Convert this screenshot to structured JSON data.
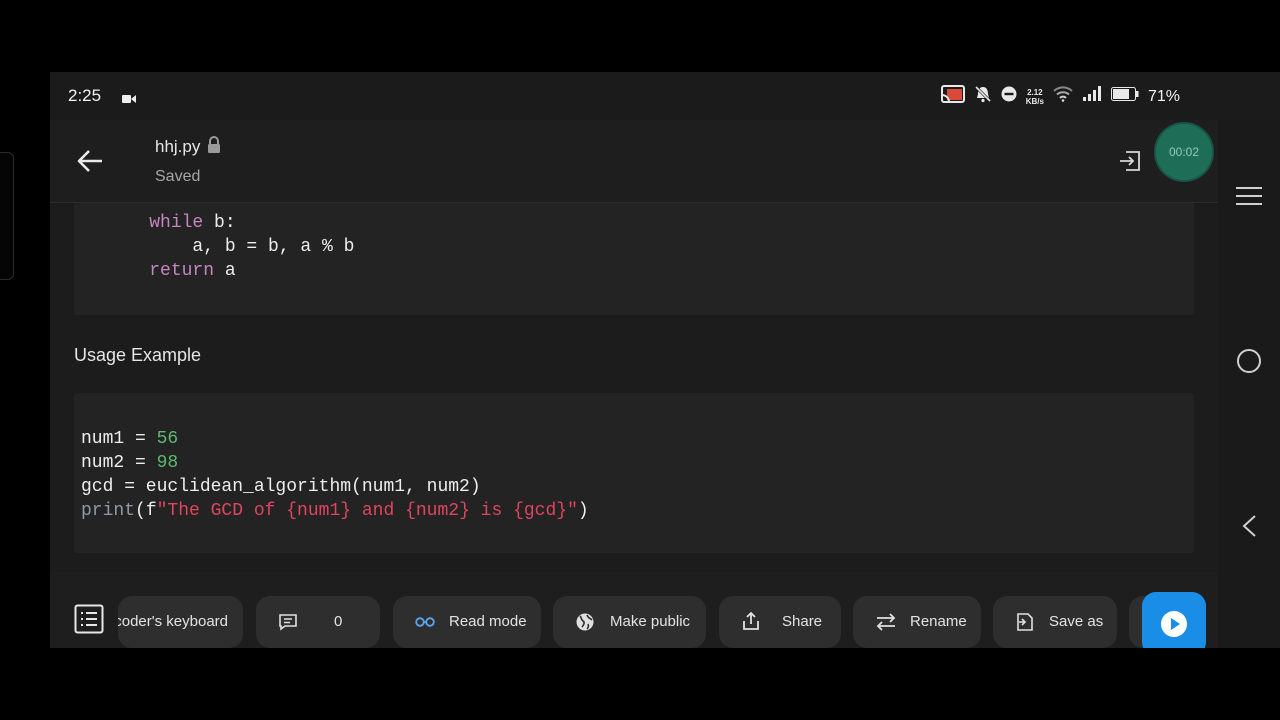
{
  "status_bar": {
    "time": "2:25",
    "net_speed_value": "2.12",
    "net_speed_unit": "KB/s",
    "battery": "71%"
  },
  "app_bar": {
    "file_name": "hhj.py",
    "save_status": "Saved",
    "timer": "00:02"
  },
  "code_top": {
    "lines": [
      [
        "    ",
        {
          "t": "while",
          "c": "kw"
        },
        " b:"
      ],
      [
        "        a, b = b, a % b"
      ],
      [
        "    ",
        {
          "t": "return",
          "c": "kw"
        },
        " a"
      ]
    ]
  },
  "section": {
    "usage_title": "Usage Example"
  },
  "code_usage": {
    "lines": [
      [
        "num1 = ",
        {
          "t": "56",
          "c": "num"
        }
      ],
      [
        "num2 = ",
        {
          "t": "98",
          "c": "num"
        }
      ],
      [
        "gcd = euclidean_algorithm(num1, num2)"
      ],
      [
        {
          "t": "print",
          "c": "fn-muted"
        },
        "(f",
        {
          "t": "\"The GCD of {num1} and {num2} is {gcd}\"",
          "c": "str"
        },
        ")"
      ]
    ]
  },
  "toolbar": {
    "keyboard_label": "coder's keyboard",
    "comments_count": "0",
    "read_mode_label": "Read mode",
    "make_public_label": "Make public",
    "share_label": "Share",
    "rename_label": "Rename",
    "save_as_label": "Save as"
  },
  "colors": {
    "keyword": "#c586c0",
    "number": "#5fb870",
    "string": "#e0445e",
    "run_button": "#1a8ee6",
    "timer_bg": "#1e6e57"
  }
}
